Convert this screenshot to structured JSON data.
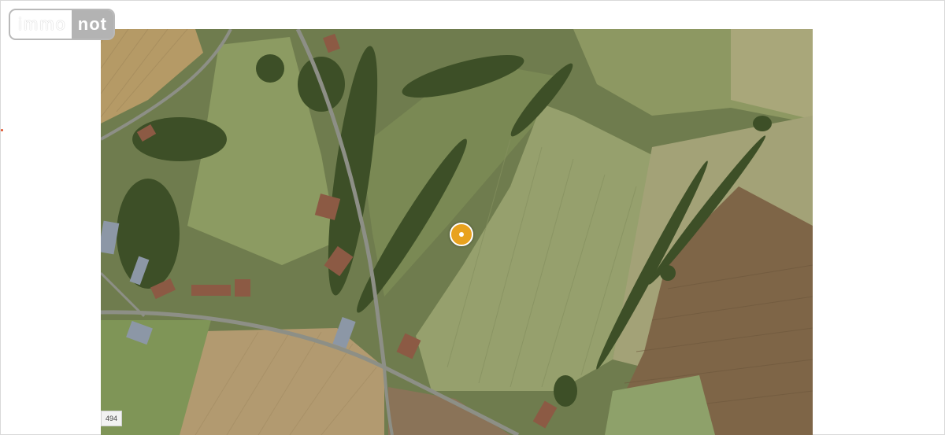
{
  "logo": {
    "part1": "immo",
    "part2": "not"
  },
  "map": {
    "type": "satellite",
    "scale_label": "494",
    "marker": {
      "icon": "location-pin-icon",
      "color": "#e8a21f"
    }
  }
}
